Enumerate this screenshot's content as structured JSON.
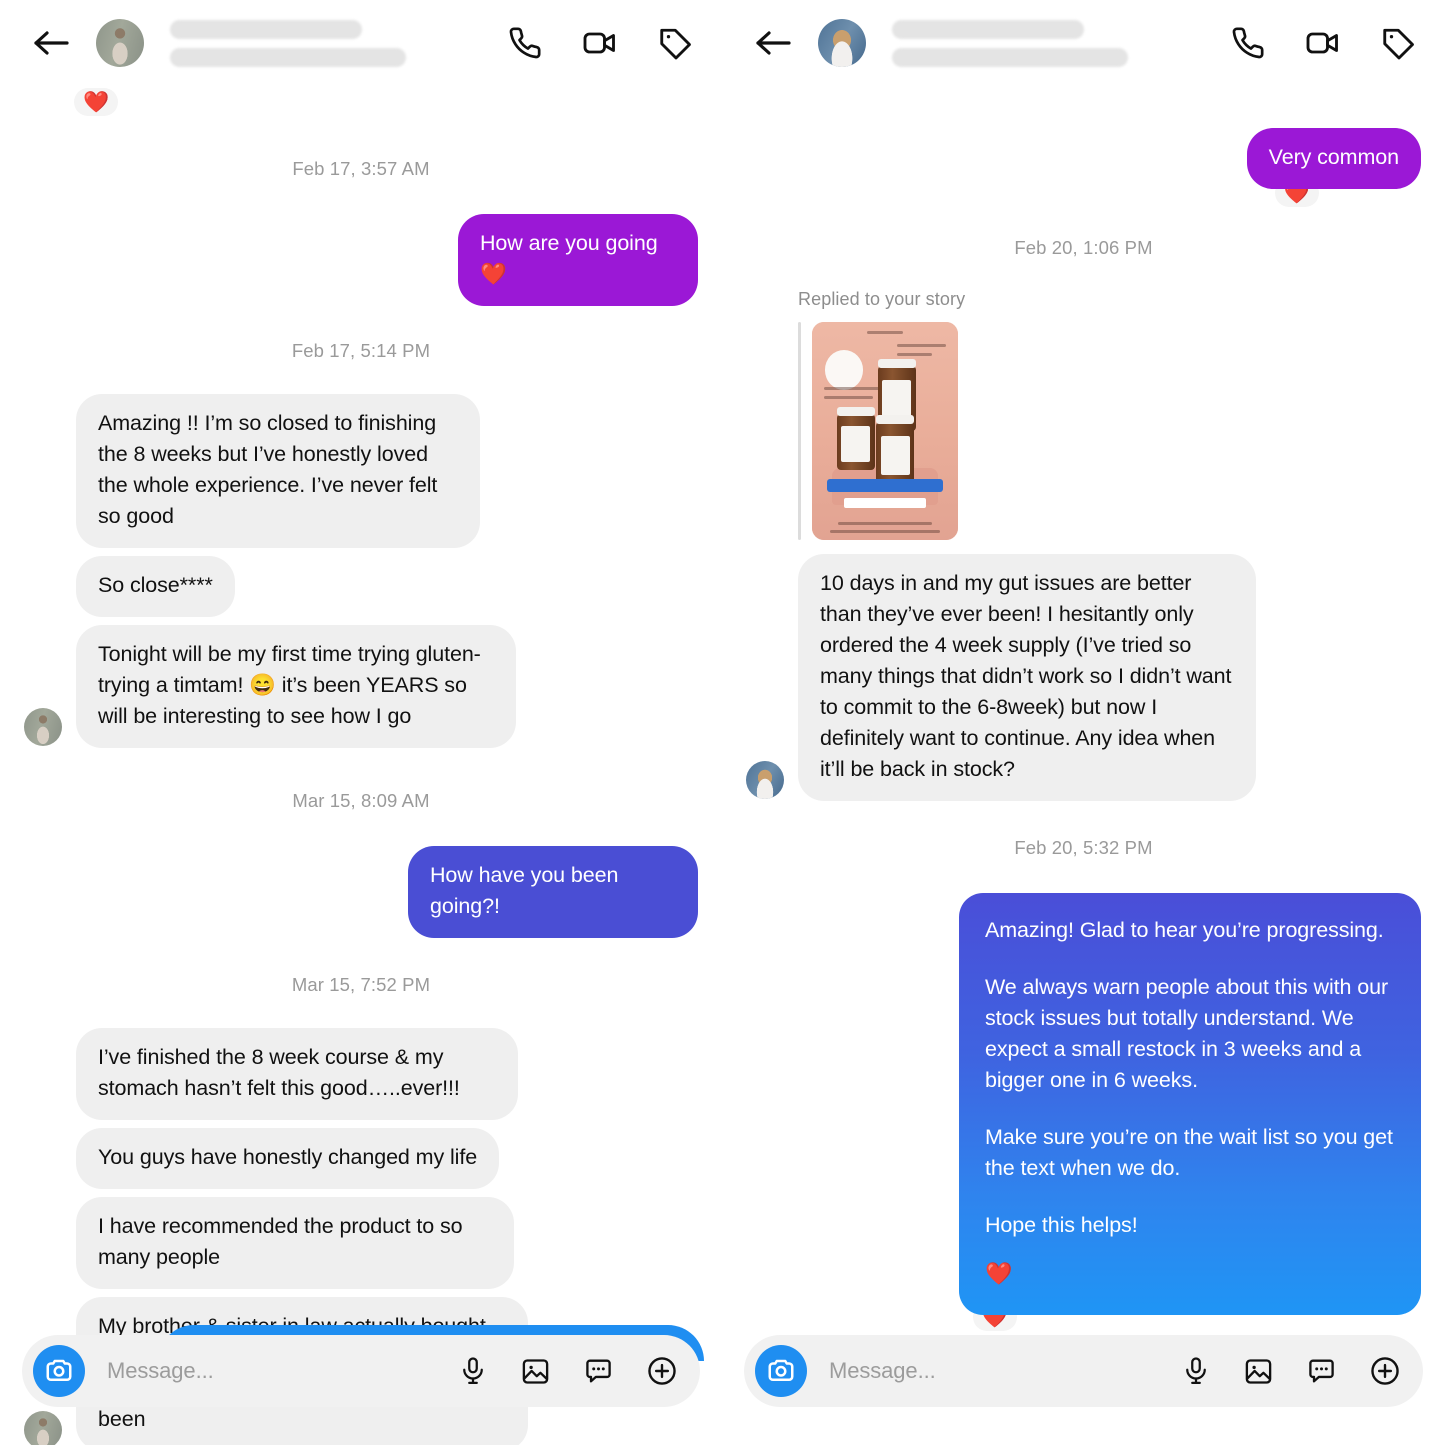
{
  "app": {
    "name": "instagram-direct-messages"
  },
  "header": {
    "back_icon": "back-arrow-icon",
    "name_redacted": true,
    "icons": [
      "phone-icon",
      "video-camera-icon",
      "tag-icon"
    ]
  },
  "composer": {
    "placeholder": "Message...",
    "camera_icon": "camera-icon",
    "icons": [
      "microphone-icon",
      "photo-icon",
      "sticker-icon",
      "plus-icon"
    ]
  },
  "colors": {
    "purple_bubble": "#9b18d6",
    "indigo_bubble": "#4a4ed4",
    "gradient_top": "#4a4ed8",
    "gradient_bottom": "#1f95f5",
    "incoming_bubble": "#efefef",
    "accent_blue": "#1f8ef1",
    "timestamp": "#9a9a9a"
  },
  "left_conversation": {
    "reaction_top": "❤️",
    "timestamps": {
      "t1": "Feb 17, 3:57 AM",
      "t2": "Feb 17, 5:14 PM",
      "t3": "Mar 15, 8:09 AM",
      "t4": "Mar 15, 7:52 PM"
    },
    "messages": {
      "m1": "How are you going ❤️",
      "m2": "Amazing !! I’m so closed to finishing the 8 weeks but I’ve honestly loved the whole experience. I’ve never felt so good",
      "m3": "So close****",
      "m4": "Tonight will be my first time trying gluten- trying a timtam! 😄 it’s been YEARS so will be interesting to see how I go",
      "m5": "How have you been going?!",
      "m6": "I’ve finished the 8 week course & my stomach hasn’t felt this good…..ever!!!",
      "m7": "You guys have honestly changed my life",
      "m8": "I have recommended the product to so many people",
      "m9": "My brother & sister in law actually bought some of the products not long ago because of how amazing my results have been"
    }
  },
  "right_conversation": {
    "reaction_top": "❤️",
    "reaction_bubble": "❤️",
    "reaction_outside": "❤️",
    "story_label": "Replied to your story",
    "timestamps": {
      "t1": "Feb 20, 1:06 PM",
      "t2": "Feb 20, 5:32 PM"
    },
    "messages": {
      "m1": "Very common",
      "m2": "10 days in and my gut issues are better than they’ve ever been!  I hesitantly only ordered the 4 week supply (I’ve tried so many things that didn’t work so I didn’t want to commit to the 6-8week) but now I definitely want to continue. Any idea when it’ll be back in stock?",
      "m3_p1": "Amazing! Glad to hear you’re progressing.",
      "m3_p2": "We always warn people about this with our stock issues but totally understand. We expect a small restock in 3 weeks and a bigger one in 6 weeks.",
      "m3_p3": "Make sure you’re on the wait list so you get the text when we do.",
      "m3_p4": "Hope this helps!"
    }
  }
}
